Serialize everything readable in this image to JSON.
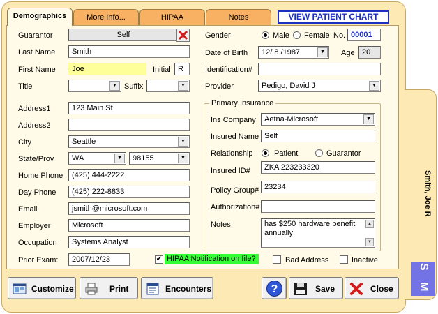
{
  "tabs": {
    "demographics": "Demographics",
    "more_info": "More Info...",
    "hipaa": "HIPAA",
    "notes": "Notes",
    "view_chart": "VIEW PATIENT CHART"
  },
  "left": {
    "guarantor_label": "Guarantor",
    "guarantor_value": "Self",
    "last_name_label": "Last Name",
    "last_name": "Smith",
    "first_name_label": "First Name",
    "first_name": "Joe",
    "initial_label": "Initial",
    "initial": "R",
    "title_label": "Title",
    "title": "",
    "suffix_label": "Suffix",
    "suffix": "",
    "address1_label": "Address1",
    "address1": "123 Main St",
    "address2_label": "Address2",
    "address2": "",
    "city_label": "City",
    "city": "Seattle",
    "state_label": "State/Prov",
    "state": "WA",
    "zip": "98155",
    "home_phone_label": "Home Phone",
    "home_phone": "(425) 444-2222",
    "day_phone_label": "Day Phone",
    "day_phone": "(425) 222-8833",
    "email_label": "Email",
    "email": "jsmith@microsoft.com",
    "employer_label": "Employer",
    "employer": "Microsoft",
    "occupation_label": "Occupation",
    "occupation": "Systems Analyst",
    "prior_exam_label": "Prior Exam:",
    "prior_exam": "2007/12/23"
  },
  "right": {
    "gender_label": "Gender",
    "male_label": "Male",
    "female_label": "Female",
    "gender_selected": "Male",
    "no_label": "No.",
    "patient_no": "00001",
    "dob_label": "Date of Birth",
    "dob": "12/ 8 /1987",
    "age_label": "Age",
    "age": "20",
    "id_label": "Identification#",
    "id_value": "",
    "provider_label": "Provider",
    "provider": "Pedigo, David J"
  },
  "insurance": {
    "group_title": "Primary Insurance",
    "company_label": "Ins Company",
    "company": "Aetna-Microsoft",
    "insured_name_label": "Insured Name",
    "insured_name": "Self",
    "relationship_label": "Relationship",
    "patient_label": "Patient",
    "guarantor_label": "Guarantor",
    "relationship_selected": "Patient",
    "insured_id_label": "Insured ID#",
    "insured_id": "ZKA 223233320",
    "policy_group_label": "Policy Group#",
    "policy_group": "23234",
    "authorization_label": "Authorization#",
    "authorization": "",
    "notes_label": "Notes",
    "notes": "has $250 hardware benefit annually"
  },
  "flags": {
    "hipaa_label": "HIPAA Notification on file?",
    "hipaa_checked": true,
    "bad_address_label": "Bad Address",
    "bad_address_checked": false,
    "inactive_label": "Inactive",
    "inactive_checked": false
  },
  "buttons": {
    "customize": "Customize",
    "print": "Print",
    "encounters": "Encounters",
    "save": "Save",
    "close": "Close"
  },
  "side": {
    "patient_name": "Smith, Joe R",
    "badge": "S M"
  },
  "colors": {
    "frame": "#fce9b4",
    "panel": "#fffbe8",
    "tab_inactive": "#f8b162",
    "accent_blue": "#1d2fc2",
    "hipaa_green": "#33ff33",
    "highlight_yellow": "#ffff99",
    "badge": "#7373e6"
  }
}
